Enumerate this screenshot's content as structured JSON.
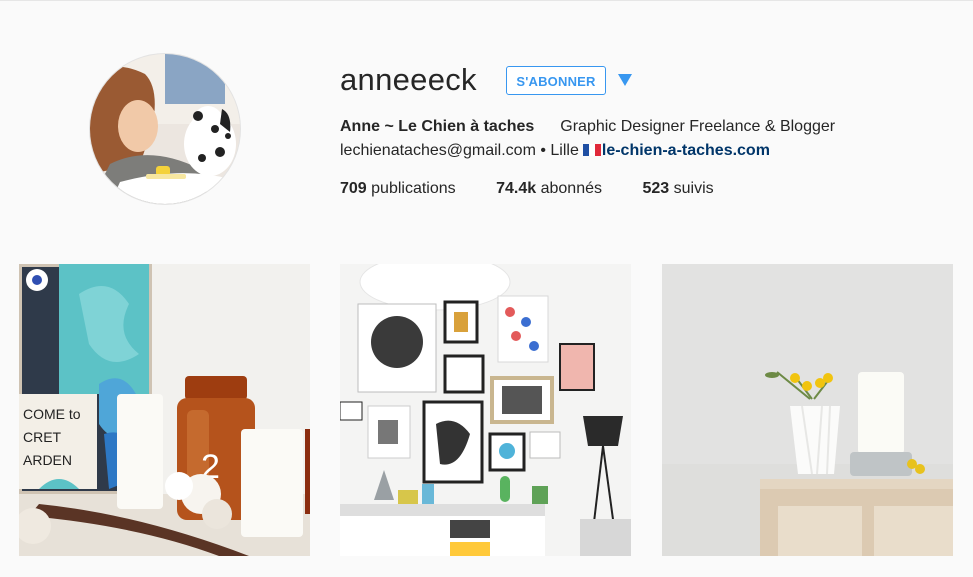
{
  "profile": {
    "username": "anneeeck",
    "follow_label": "S'ABONNER",
    "full_name": "Anne ~ Le Chien à taches",
    "bio": "Graphic Designer Freelance & Blogger",
    "email": "lechienataches@gmail.com",
    "separator": "•",
    "location": "Lille",
    "website": "le-chien-a-taches.com"
  },
  "stats": {
    "posts_count": "709",
    "posts_label": "publications",
    "followers_count": "74.4k",
    "followers_label": "abonnés",
    "following_count": "523",
    "following_label": "suivis"
  },
  "poster_text": {
    "line1": "COME to",
    "line2": "CRET",
    "line3": "ARDEN"
  },
  "icons": {
    "dropdown": "chevron-down-icon",
    "flag": "france-flag-icon"
  },
  "colors": {
    "accent": "#3897f0",
    "link": "#003569",
    "text": "#262626",
    "background": "#fafafa"
  }
}
